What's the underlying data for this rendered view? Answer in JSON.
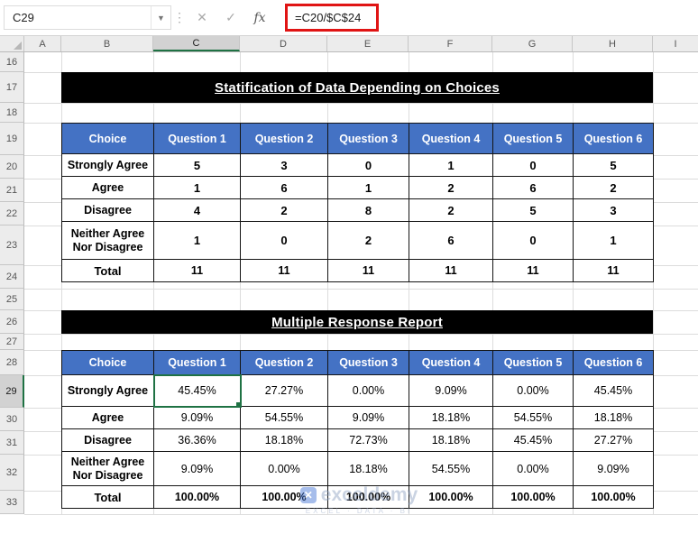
{
  "formula_bar": {
    "name_box": "C29",
    "cancel_label": "✕",
    "enter_label": "✓",
    "fx_label": "fx",
    "formula": "=C20/$C$24"
  },
  "grid": {
    "columns": [
      "A",
      "B",
      "C",
      "D",
      "E",
      "F",
      "G",
      "H",
      "I"
    ],
    "rows": [
      "16",
      "17",
      "18",
      "19",
      "20",
      "21",
      "22",
      "23",
      "24",
      "25",
      "26",
      "27",
      "28",
      "29",
      "30",
      "31",
      "32",
      "33"
    ],
    "selected_cell": "C29"
  },
  "banners": {
    "table1_title": "Statification of Data Depending on Choices",
    "table2_title": "Multiple Response Report"
  },
  "table1": {
    "headers": [
      "Choice",
      "Question 1",
      "Question 2",
      "Question 3",
      "Question 4",
      "Question 5",
      "Question 6"
    ],
    "rows": [
      {
        "label": "Strongly Agree",
        "values": [
          "5",
          "3",
          "0",
          "1",
          "0",
          "5"
        ]
      },
      {
        "label": "Agree",
        "values": [
          "1",
          "6",
          "1",
          "2",
          "6",
          "2"
        ]
      },
      {
        "label": "Disagree",
        "values": [
          "4",
          "2",
          "8",
          "2",
          "5",
          "3"
        ]
      },
      {
        "label": "Neither Agree Nor Disagree",
        "values": [
          "1",
          "0",
          "2",
          "6",
          "0",
          "1"
        ]
      },
      {
        "label": "Total",
        "values": [
          "11",
          "11",
          "11",
          "11",
          "11",
          "11"
        ]
      }
    ]
  },
  "table2": {
    "headers": [
      "Choice",
      "Question 1",
      "Question 2",
      "Question 3",
      "Question 4",
      "Question 5",
      "Question 6"
    ],
    "rows": [
      {
        "label": "Strongly Agree",
        "values": [
          "45.45%",
          "27.27%",
          "0.00%",
          "9.09%",
          "0.00%",
          "45.45%"
        ]
      },
      {
        "label": "Agree",
        "values": [
          "9.09%",
          "54.55%",
          "9.09%",
          "18.18%",
          "54.55%",
          "18.18%"
        ]
      },
      {
        "label": "Disagree",
        "values": [
          "36.36%",
          "18.18%",
          "72.73%",
          "18.18%",
          "45.45%",
          "27.27%"
        ]
      },
      {
        "label": "Neither Agree Nor Disagree",
        "values": [
          "9.09%",
          "0.00%",
          "18.18%",
          "54.55%",
          "0.00%",
          "9.09%"
        ]
      },
      {
        "label": "Total",
        "values": [
          "100.00%",
          "100.00%",
          "100.00%",
          "100.00%",
          "100.00%",
          "100.00%"
        ]
      }
    ]
  },
  "watermark": {
    "logo": "✕",
    "name": "exceldemy",
    "tagline": "EXCEL · DATA · BI"
  },
  "colors": {
    "header_fill": "#4472C4",
    "label_fill": "#B4C6E7",
    "banner_fill": "#000000",
    "total_label_text": "#F00000",
    "total_value_text": "#2F5FA8",
    "selection": "#1F7244",
    "formula_highlight": "#E01414"
  }
}
